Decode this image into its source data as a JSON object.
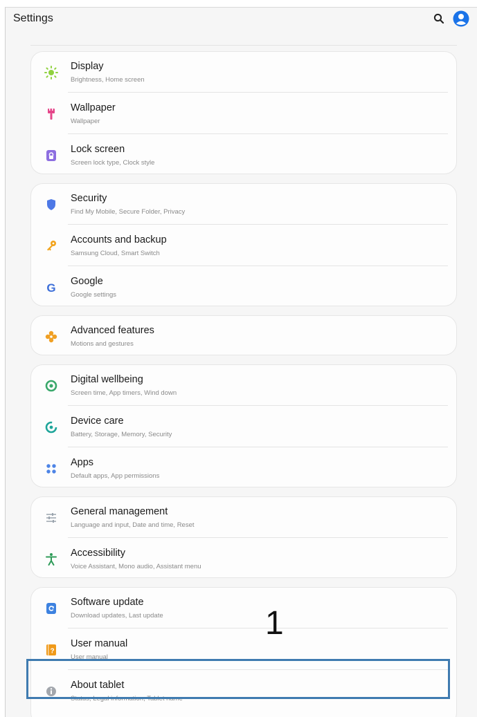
{
  "header": {
    "title": "Settings",
    "search_icon": "search-icon",
    "account_icon": "account-icon"
  },
  "groups": [
    {
      "items": [
        {
          "label": "Display",
          "subtitle": "Brightness, Home screen",
          "icon": "sun-icon"
        },
        {
          "label": "Wallpaper",
          "subtitle": "Wallpaper",
          "icon": "brush-icon"
        },
        {
          "label": "Lock screen",
          "subtitle": "Screen lock type, Clock style",
          "icon": "lock-icon"
        }
      ]
    },
    {
      "items": [
        {
          "label": "Security",
          "subtitle": "Find My Mobile, Secure Folder, Privacy",
          "icon": "shield-icon"
        },
        {
          "label": "Accounts and backup",
          "subtitle": "Samsung Cloud, Smart Switch",
          "icon": "key-icon"
        },
        {
          "label": "Google",
          "subtitle": "Google settings",
          "icon": "google-icon"
        }
      ]
    },
    {
      "items": [
        {
          "label": "Advanced features",
          "subtitle": "Motions and gestures",
          "icon": "gear-flower-icon"
        }
      ]
    },
    {
      "items": [
        {
          "label": "Digital wellbeing",
          "subtitle": "Screen time, App timers, Wind down",
          "icon": "wellbeing-icon"
        },
        {
          "label": "Device care",
          "subtitle": "Battery, Storage, Memory, Security",
          "icon": "device-care-icon"
        },
        {
          "label": "Apps",
          "subtitle": "Default apps, App permissions",
          "icon": "apps-grid-icon"
        }
      ]
    },
    {
      "items": [
        {
          "label": "General management",
          "subtitle": "Language and input, Date and time, Reset",
          "icon": "sliders-icon"
        },
        {
          "label": "Accessibility",
          "subtitle": "Voice Assistant, Mono audio, Assistant menu",
          "icon": "accessibility-icon"
        }
      ]
    },
    {
      "items": [
        {
          "label": "Software update",
          "subtitle": "Download updates, Last update",
          "icon": "update-icon"
        },
        {
          "label": "User manual",
          "subtitle": "User manual",
          "icon": "manual-icon"
        },
        {
          "label": "About tablet",
          "subtitle": "Status, Legal information, Tablet name",
          "icon": "info-icon"
        }
      ]
    }
  ],
  "annotation": {
    "step_number": "1",
    "highlight_color": "#3f7bb0"
  },
  "colors": {
    "accent_blue": "#1a73e8",
    "background": "#f6f6f6",
    "card": "#fdfdfd"
  }
}
